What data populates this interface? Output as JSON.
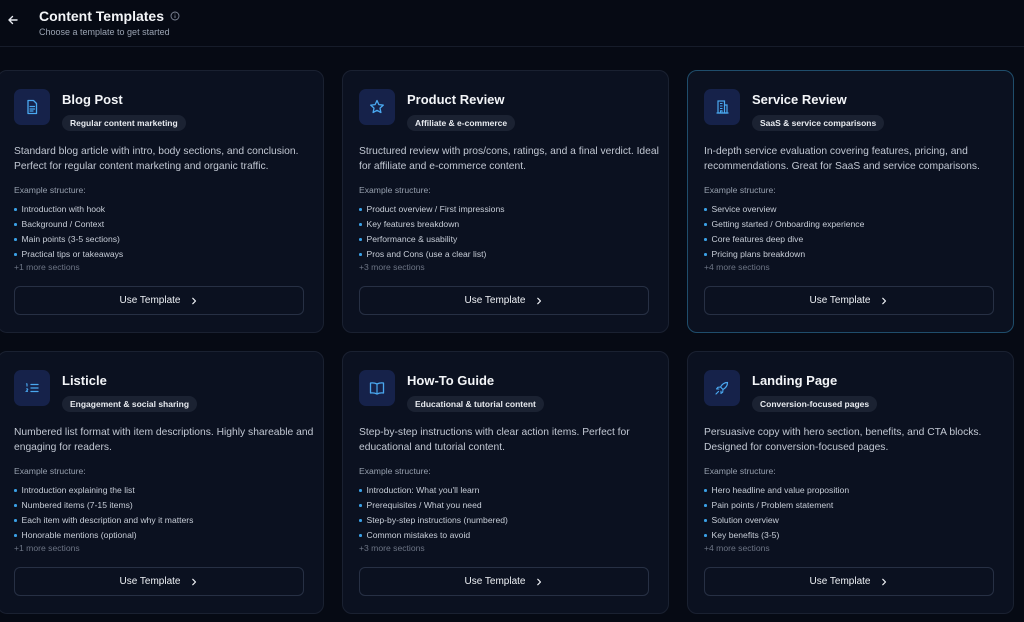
{
  "header": {
    "title": "Content Templates",
    "subtitle": "Choose a template to get started"
  },
  "colors": {
    "background": "#060a14",
    "card": "#0b1120",
    "icon_box": "#16224a",
    "accent": "#3aa0e6",
    "selected_border": "#1f4d6b"
  },
  "button_label": "Use Template",
  "example_label": "Example structure:",
  "templates": [
    {
      "title": "Blog Post",
      "icon": "document-icon",
      "badge": "Regular content marketing",
      "description": "Standard blog article with intro, body sections, and conclusion. Perfect for regular content marketing and organic traffic.",
      "sections": [
        "Introduction with hook",
        "Background / Context",
        "Main points (3-5 sections)",
        "Practical tips or takeaways"
      ],
      "more": "+1 more sections",
      "selected": false
    },
    {
      "title": "Product Review",
      "icon": "star-icon",
      "badge": "Affiliate & e-commerce",
      "description": "Structured review with pros/cons, ratings, and a final verdict. Ideal for affiliate and e-commerce content.",
      "sections": [
        "Product overview / First impressions",
        "Key features breakdown",
        "Performance & usability",
        "Pros and Cons (use a clear list)"
      ],
      "more": "+3 more sections",
      "selected": false
    },
    {
      "title": "Service Review",
      "icon": "building-icon",
      "badge": "SaaS & service comparisons",
      "description": "In-depth service evaluation covering features, pricing, and recommendations. Great for SaaS and service comparisons.",
      "sections": [
        "Service overview",
        "Getting started / Onboarding experience",
        "Core features deep dive",
        "Pricing plans breakdown"
      ],
      "more": "+4 more sections",
      "selected": true
    },
    {
      "title": "Listicle",
      "icon": "list-icon",
      "badge": "Engagement & social sharing",
      "description": "Numbered list format with item descriptions. Highly shareable and engaging for readers.",
      "sections": [
        "Introduction explaining the list",
        "Numbered items (7-15 items)",
        "Each item with description and why it matters",
        "Honorable mentions (optional)"
      ],
      "more": "+1 more sections",
      "selected": false
    },
    {
      "title": "How-To Guide",
      "icon": "book-icon",
      "badge": "Educational & tutorial content",
      "description": "Step-by-step instructions with clear action items. Perfect for educational and tutorial content.",
      "sections": [
        "Introduction: What you'll learn",
        "Prerequisites / What you need",
        "Step-by-step instructions (numbered)",
        "Common mistakes to avoid"
      ],
      "more": "+3 more sections",
      "selected": false
    },
    {
      "title": "Landing Page",
      "icon": "rocket-icon",
      "badge": "Conversion-focused pages",
      "description": "Persuasive copy with hero section, benefits, and CTA blocks. Designed for conversion-focused pages.",
      "sections": [
        "Hero headline and value proposition",
        "Pain points / Problem statement",
        "Solution overview",
        "Key benefits (3-5)"
      ],
      "more": "+4 more sections",
      "selected": false
    }
  ]
}
